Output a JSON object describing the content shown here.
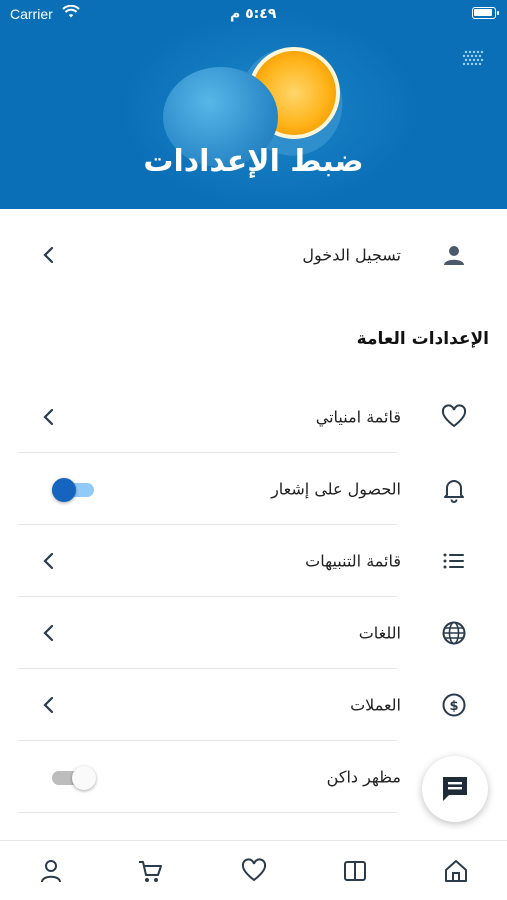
{
  "status_bar": {
    "carrier": "Carrier",
    "time": "٥:٤٩ م"
  },
  "header": {
    "title": "ضبط الإعدادات",
    "background_color": "#0b6fb7"
  },
  "login_row": {
    "label": "تسجيل الدخول",
    "icon": "person-icon"
  },
  "general_settings": {
    "title": "الإعدادات العامة",
    "items": [
      {
        "label": "قائمة امنياتي",
        "icon": "heart-icon",
        "control": "chevron"
      },
      {
        "label": "الحصول على إشعار",
        "icon": "bell-icon",
        "control": "toggle",
        "toggle_on": true
      },
      {
        "label": "قائمة التنبيهات",
        "icon": "list-icon",
        "control": "chevron"
      },
      {
        "label": "اللغات",
        "icon": "globe-icon",
        "control": "chevron"
      },
      {
        "label": "العملات",
        "icon": "dollar-circle-icon",
        "control": "chevron"
      },
      {
        "label": "مظهر داكن",
        "icon": "moon-icon",
        "control": "toggle",
        "toggle_on": false
      }
    ]
  },
  "fab": {
    "icon": "chat-icon"
  },
  "bottom_nav": {
    "items": [
      "profile-icon",
      "cart-icon",
      "heart-icon",
      "book-icon",
      "home-icon"
    ],
    "active_color": "#2a3b4c"
  },
  "colors": {
    "accent": "#1565c0",
    "icon": "#4a5a6a",
    "toggle_on_track": "#90caf9",
    "toggle_off_track": "#bdbdbd"
  }
}
